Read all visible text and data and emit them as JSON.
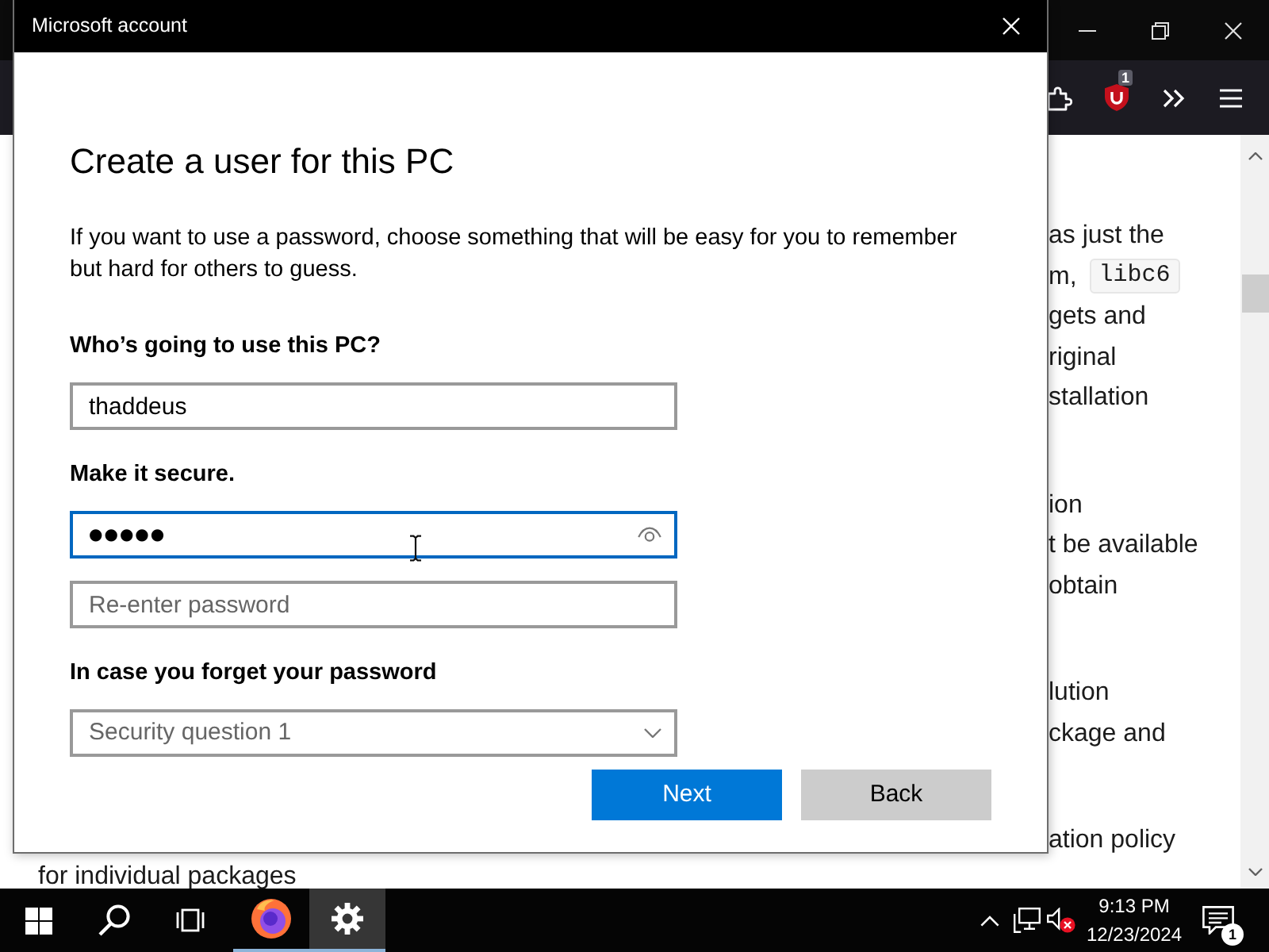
{
  "browser": {
    "extension_badge": "1"
  },
  "page": {
    "paragraphs": [
      [
        {
          "text": "as just the"
        },
        {
          "text": "m,",
          "code": "libc6"
        },
        {
          "text": "gets and"
        },
        {
          "text": "riginal"
        },
        {
          "text": "stallation"
        }
      ],
      [
        {
          "text": "ion"
        },
        {
          "text": "t be available"
        },
        {
          "text": "obtain"
        }
      ],
      [
        {
          "text": "lution"
        },
        {
          "text": "ckage and"
        }
      ],
      [
        {
          "text": "ation policy"
        }
      ]
    ],
    "bottom_line": "for individual packages"
  },
  "dialog": {
    "title": "Microsoft account",
    "heading": "Create a user for this PC",
    "instructions": "If you want to use a password, choose something that will be easy for you to remember but hard for others to guess.",
    "form": [
      {
        "kind": "label",
        "text": "Who’s going to use this PC?"
      },
      {
        "kind": "text_field",
        "value": "thaddeus",
        "focused": false
      },
      {
        "kind": "label",
        "text": "Make it secure."
      },
      {
        "kind": "password_field",
        "value": "●●●●●",
        "focused": true
      },
      {
        "kind": "text_field",
        "placeholder": "Re-enter password",
        "focused": false
      },
      {
        "kind": "label",
        "text": "In case you forget your password"
      },
      {
        "kind": "dropdown",
        "placeholder": "Security question 1"
      }
    ],
    "buttons": [
      {
        "label": "Next",
        "kind": "primary"
      },
      {
        "label": "Back",
        "kind": "secondary"
      }
    ]
  },
  "taskbar": {
    "apps": [
      {
        "kind": "browser",
        "running": true,
        "selected": false
      },
      {
        "kind": "settings",
        "running": true,
        "selected": true
      }
    ],
    "volume_muted": true,
    "clock": {
      "time": "9:13 PM",
      "date": "12/23/2024"
    },
    "notification_count": "1"
  }
}
